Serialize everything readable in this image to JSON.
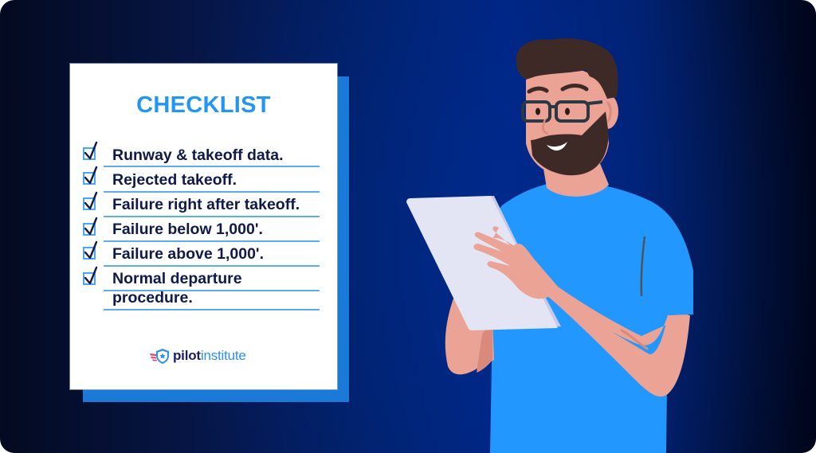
{
  "checklist": {
    "title": "CHECKLIST",
    "items": [
      {
        "label": "Runway & takeoff data.",
        "checked": true
      },
      {
        "label": "Rejected takeoff.",
        "checked": true
      },
      {
        "label": "Failure right after takeoff.",
        "checked": true
      },
      {
        "label": "Failure below 1,000'.",
        "checked": true
      },
      {
        "label": "Failure above 1,000'.",
        "checked": true
      },
      {
        "label": "Normal departure",
        "label_line2": "procedure.",
        "checked": true
      }
    ]
  },
  "brand": {
    "logo_icon": "winged-shield-star-icon",
    "name_part1": "pilot",
    "name_part2": "institute"
  },
  "illustration": {
    "subject": "bearded-man-with-glasses-reading-tablet"
  },
  "colors": {
    "accent": "#2196f3",
    "text_dark": "#0f1a4b",
    "shirt": "#2298fe",
    "skin": "#eaa394",
    "hair": "#3d2a26",
    "card_shadow": "#1b79d8",
    "logo_pink": "#f0386b"
  }
}
